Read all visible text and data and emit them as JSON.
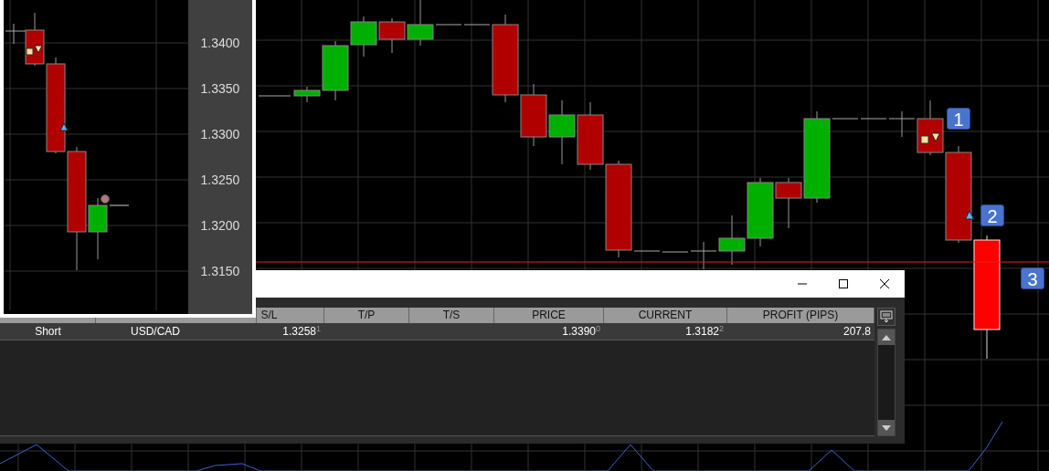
{
  "chart": {
    "badges": [
      {
        "label": "1"
      },
      {
        "label": "2"
      },
      {
        "label": "3"
      }
    ]
  },
  "inset": {
    "axis_labels": [
      "1.3400",
      "1.3350",
      "1.3300",
      "1.3250",
      "1.3200",
      "1.3150"
    ]
  },
  "trade_window": {
    "table": {
      "columns": [
        "S/L",
        "T/P",
        "T/S",
        "PRICE",
        "CURRENT",
        "PROFIT (PIPS)"
      ],
      "rows": [
        {
          "cells": [
            "Short",
            "USD/CAD",
            "1.3258$^{1}$",
            null,
            null,
            "1.3390$^{0}$",
            "1.3182$^{2}$",
            "207.8"
          ]
        }
      ]
    }
  }
}
